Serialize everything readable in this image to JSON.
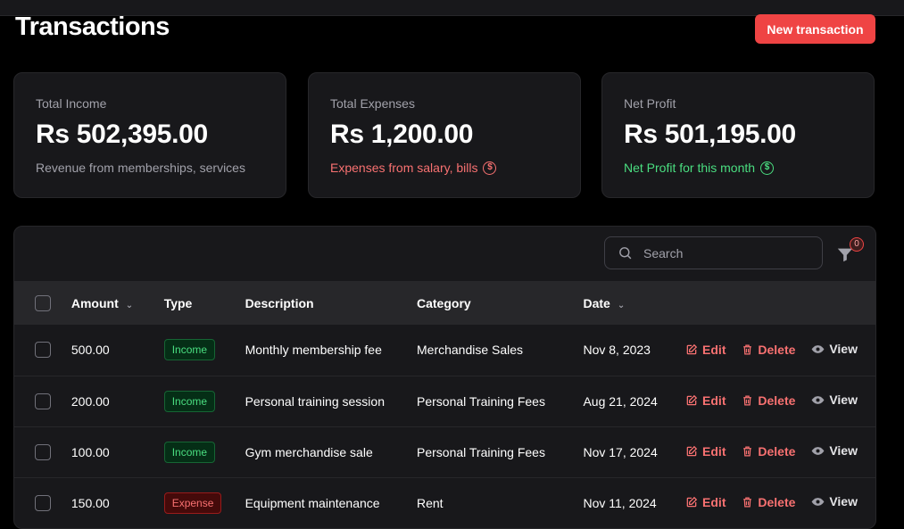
{
  "header": {
    "title": "Transactions",
    "new_button": "New transaction"
  },
  "cards": [
    {
      "label": "Total Income",
      "value": "Rs 502,395.00",
      "note": "Revenue from memberships, services"
    },
    {
      "label": "Total Expenses",
      "value": "Rs 1,200.00",
      "note": "Expenses from salary, bills"
    },
    {
      "label": "Net Profit",
      "value": "Rs 501,195.00",
      "note": "Net Profit for this month"
    }
  ],
  "toolbar": {
    "search_placeholder": "Search",
    "filter_count": "0"
  },
  "table": {
    "columns": {
      "amount": "Amount",
      "type": "Type",
      "description": "Description",
      "category": "Category",
      "date": "Date"
    },
    "action_labels": {
      "edit": "Edit",
      "delete": "Delete",
      "view": "View"
    },
    "rows": [
      {
        "amount": "500.00",
        "type": "Income",
        "description": "Monthly membership fee",
        "category": "Merchandise Sales",
        "date": "Nov 8, 2023"
      },
      {
        "amount": "200.00",
        "type": "Income",
        "description": "Personal training session",
        "category": "Personal Training Fees",
        "date": "Aug 21, 2024"
      },
      {
        "amount": "100.00",
        "type": "Income",
        "description": "Gym merchandise sale",
        "category": "Personal Training Fees",
        "date": "Nov 17, 2024"
      },
      {
        "amount": "150.00",
        "type": "Expense",
        "description": "Equipment maintenance",
        "category": "Rent",
        "date": "Nov 11, 2024"
      }
    ]
  },
  "colors": {
    "accent": "#ef4444",
    "income": "#4ade80",
    "expense": "#f87171",
    "background": "#000000",
    "surface": "#18181b"
  }
}
